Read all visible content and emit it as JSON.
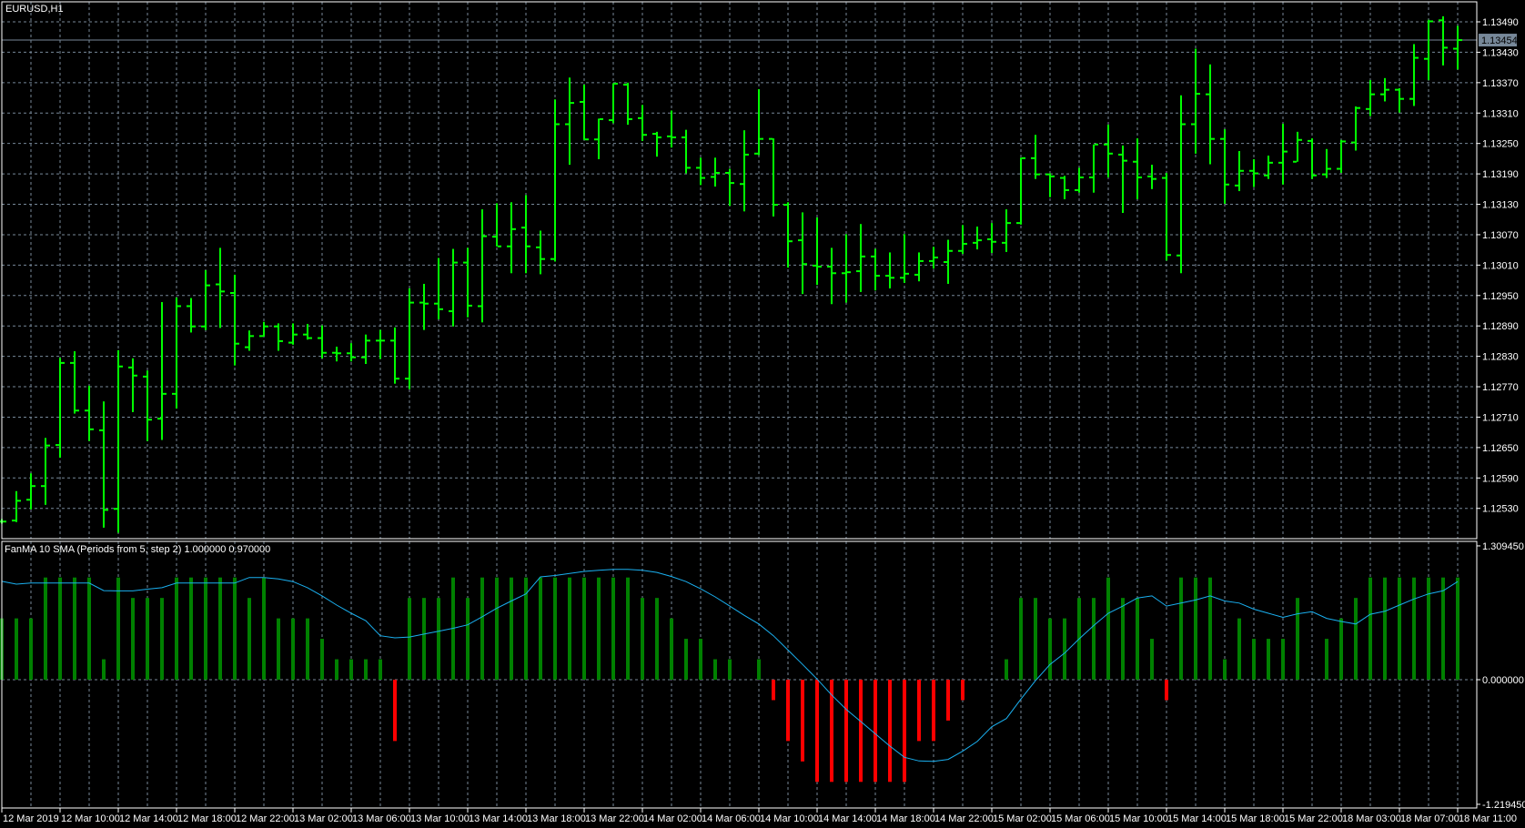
{
  "colors": {
    "background": "#000000",
    "frame": "#ffffff",
    "grid": "#778899",
    "bar": "#00ff00",
    "hist_up": "#008000",
    "hist_down": "#ff0000",
    "signal_line": "#1ab0f0",
    "bid_box": "#778899"
  },
  "chart_data": [
    {
      "type": "bar",
      "style": "ohlc",
      "title": "EURUSD,H1",
      "bid": 1.13454,
      "bid_label": "1.13454",
      "ylim": [
        1.1247,
        1.13529
      ],
      "y_tick_labels": [
        "1.13490",
        "1.13430",
        "1.13370",
        "1.13310",
        "1.13250",
        "1.13190",
        "1.13130",
        "1.13070",
        "1.13010",
        "1.12950",
        "1.12890",
        "1.12830",
        "1.12770",
        "1.12710",
        "1.12650",
        "1.12590",
        "1.12530"
      ],
      "x_tick_labels": [
        "12 Mar 2019",
        "12 Mar 10:00",
        "12 Mar 14:00",
        "12 Mar 18:00",
        "12 Mar 22:00",
        "13 Mar 02:00",
        "13 Mar 06:00",
        "13 Mar 10:00",
        "13 Mar 14:00",
        "13 Mar 18:00",
        "13 Mar 22:00",
        "14 Mar 02:00",
        "14 Mar 06:00",
        "14 Mar 10:00",
        "14 Mar 14:00",
        "14 Mar 18:00",
        "14 Mar 22:00",
        "15 Mar 02:00",
        "15 Mar 06:00",
        "15 Mar 10:00",
        "15 Mar 14:00",
        "15 Mar 18:00",
        "15 Mar 22:00",
        "18 Mar 03:00",
        "18 Mar 07:00",
        "18 Mar 11:00"
      ],
      "x_tick_every_bars": 4,
      "grid": true,
      "ohlc": [
        [
          1.12504,
          1.12509,
          1.125,
          1.12504
        ],
        [
          1.12506,
          1.12564,
          1.12503,
          1.12545
        ],
        [
          1.12547,
          1.12599,
          1.12528,
          1.12574
        ],
        [
          1.12574,
          1.12669,
          1.12537,
          1.12654
        ],
        [
          1.12655,
          1.12827,
          1.1263,
          1.12817
        ],
        [
          1.12817,
          1.1284,
          1.12717,
          1.12723
        ],
        [
          1.12723,
          1.12772,
          1.12663,
          1.12686
        ],
        [
          1.12684,
          1.12741,
          1.12492,
          1.12527
        ],
        [
          1.12529,
          1.12842,
          1.12482,
          1.1281
        ],
        [
          1.12808,
          1.12826,
          1.1272,
          1.12792
        ],
        [
          1.1279,
          1.12802,
          1.12663,
          1.12705
        ],
        [
          1.12707,
          1.12937,
          1.12665,
          1.12756
        ],
        [
          1.12756,
          1.12946,
          1.12727,
          1.12929
        ],
        [
          1.12929,
          1.12945,
          1.12877,
          1.12889
        ],
        [
          1.12889,
          1.13,
          1.12882,
          1.1297
        ],
        [
          1.12972,
          1.13044,
          1.12886,
          1.12958
        ],
        [
          1.12955,
          1.12991,
          1.12812,
          1.12855
        ],
        [
          1.12848,
          1.12881,
          1.12841,
          1.1287
        ],
        [
          1.1287,
          1.12898,
          1.12869,
          1.12889
        ],
        [
          1.12889,
          1.12895,
          1.12841,
          1.1286
        ],
        [
          1.12857,
          1.12895,
          1.12853,
          1.12873
        ],
        [
          1.12873,
          1.12894,
          1.12863,
          1.12866
        ],
        [
          1.12866,
          1.12891,
          1.12826,
          1.12837
        ],
        [
          1.12837,
          1.12849,
          1.1282,
          1.12836
        ],
        [
          1.12836,
          1.12856,
          1.1282,
          1.12828
        ],
        [
          1.12828,
          1.12873,
          1.12815,
          1.12861
        ],
        [
          1.12861,
          1.12882,
          1.12825,
          1.12861
        ],
        [
          1.12861,
          1.12887,
          1.12776,
          1.12786
        ],
        [
          1.12786,
          1.12964,
          1.12765,
          1.12936
        ],
        [
          1.12936,
          1.12973,
          1.12882,
          1.12934
        ],
        [
          1.12934,
          1.13024,
          1.12903,
          1.12923
        ],
        [
          1.12919,
          1.13042,
          1.12889,
          1.13015
        ],
        [
          1.13015,
          1.13044,
          1.12907,
          1.1293
        ],
        [
          1.12929,
          1.1312,
          1.12897,
          1.13067
        ],
        [
          1.13066,
          1.13132,
          1.13047,
          1.13047
        ],
        [
          1.13047,
          1.13134,
          1.12994,
          1.13081
        ],
        [
          1.13084,
          1.13148,
          1.12994,
          1.13047
        ],
        [
          1.13045,
          1.13078,
          1.12992,
          1.13022
        ],
        [
          1.13022,
          1.13337,
          1.13017,
          1.13288
        ],
        [
          1.13288,
          1.1338,
          1.13208,
          1.1333
        ],
        [
          1.13332,
          1.13366,
          1.13257,
          1.13258
        ],
        [
          1.13258,
          1.13299,
          1.13219,
          1.13298
        ],
        [
          1.13296,
          1.13369,
          1.1329,
          1.13368
        ],
        [
          1.13366,
          1.1337,
          1.13287,
          1.13298
        ],
        [
          1.133,
          1.13326,
          1.13255,
          1.13267
        ],
        [
          1.13269,
          1.13273,
          1.13224,
          1.13262
        ],
        [
          1.13264,
          1.13315,
          1.13242,
          1.13262
        ],
        [
          1.13262,
          1.13277,
          1.13191,
          1.13202
        ],
        [
          1.13202,
          1.13222,
          1.13168,
          1.13182
        ],
        [
          1.13184,
          1.13222,
          1.13165,
          1.13192
        ],
        [
          1.13192,
          1.132,
          1.13127,
          1.13172
        ],
        [
          1.1317,
          1.13276,
          1.13116,
          1.13228
        ],
        [
          1.1323,
          1.13357,
          1.13227,
          1.13259
        ],
        [
          1.13259,
          1.1326,
          1.13106,
          1.13129
        ],
        [
          1.13129,
          1.13134,
          1.13005,
          1.13057
        ],
        [
          1.13059,
          1.13114,
          1.12953,
          1.13012
        ],
        [
          1.13009,
          1.13104,
          1.12971,
          1.13007
        ],
        [
          1.13007,
          1.13044,
          1.12933,
          1.12994
        ],
        [
          1.12994,
          1.13071,
          1.12936,
          1.12996
        ],
        [
          1.12998,
          1.13091,
          1.12957,
          1.13027
        ],
        [
          1.13027,
          1.13042,
          1.1296,
          1.12989
        ],
        [
          1.12989,
          1.13035,
          1.12964,
          1.12985
        ],
        [
          1.12985,
          1.13071,
          1.12975,
          1.12993
        ],
        [
          1.12991,
          1.13035,
          1.12978,
          1.13018
        ],
        [
          1.13018,
          1.13046,
          1.13003,
          1.13025
        ],
        [
          1.13016,
          1.1306,
          1.12973,
          1.13038
        ],
        [
          1.13038,
          1.13089,
          1.13032,
          1.13052
        ],
        [
          1.13054,
          1.13086,
          1.13041,
          1.13059
        ],
        [
          1.13061,
          1.13093,
          1.13034,
          1.13056
        ],
        [
          1.13054,
          1.1312,
          1.13036,
          1.13093
        ],
        [
          1.13093,
          1.13222,
          1.1309,
          1.13221
        ],
        [
          1.13221,
          1.13267,
          1.1318,
          1.13189
        ],
        [
          1.13189,
          1.13191,
          1.13144,
          1.13185
        ],
        [
          1.13182,
          1.13186,
          1.1314,
          1.13158
        ],
        [
          1.13158,
          1.13202,
          1.13153,
          1.13183
        ],
        [
          1.13183,
          1.13248,
          1.13153,
          1.13248
        ],
        [
          1.13248,
          1.13287,
          1.13183,
          1.1323
        ],
        [
          1.13228,
          1.13246,
          1.13113,
          1.13216
        ],
        [
          1.13214,
          1.1326,
          1.1314,
          1.13183
        ],
        [
          1.13185,
          1.13208,
          1.1316,
          1.1318
        ],
        [
          1.13182,
          1.13192,
          1.13019,
          1.1303
        ],
        [
          1.13029,
          1.13345,
          1.12994,
          1.13288
        ],
        [
          1.13288,
          1.13437,
          1.1323,
          1.13348
        ],
        [
          1.13347,
          1.13406,
          1.13209,
          1.13259
        ],
        [
          1.13259,
          1.13278,
          1.13131,
          1.13169
        ],
        [
          1.13167,
          1.13235,
          1.13156,
          1.13196
        ],
        [
          1.13196,
          1.13219,
          1.13164,
          1.13191
        ],
        [
          1.13187,
          1.13226,
          1.1318,
          1.13212
        ],
        [
          1.13212,
          1.13289,
          1.13169,
          1.13234
        ],
        [
          1.13214,
          1.13273,
          1.13214,
          1.13257
        ],
        [
          1.13255,
          1.1326,
          1.1318,
          1.13187
        ],
        [
          1.13189,
          1.13239,
          1.13182,
          1.132
        ],
        [
          1.132,
          1.13257,
          1.13192,
          1.13254
        ],
        [
          1.13252,
          1.13323,
          1.13236,
          1.1332
        ],
        [
          1.13318,
          1.13375,
          1.13304,
          1.13347
        ],
        [
          1.13347,
          1.13379,
          1.13333,
          1.13356
        ],
        [
          1.13356,
          1.13359,
          1.13311,
          1.13338
        ],
        [
          1.13338,
          1.13446,
          1.13324,
          1.13419
        ],
        [
          1.13417,
          1.13494,
          1.13375,
          1.13491
        ],
        [
          1.13493,
          1.13501,
          1.13404,
          1.13439
        ],
        [
          1.13437,
          1.13482,
          1.13396,
          1.13454
        ]
      ]
    },
    {
      "type": "bar",
      "title": "FanMA 10 SMA (Periods from 5, step 2) 1.000000 0.970000",
      "ylim": [
        -1.21945,
        1.30945
      ],
      "y_tick_labels": [
        "1.309450",
        "0.000000",
        "-1.219450"
      ],
      "series": [
        {
          "name": "histogram",
          "values": [
            0.6,
            0.6,
            0.6,
            1,
            1,
            1,
            1,
            0.2,
            1,
            0.8,
            0.8,
            0.8,
            1,
            1,
            1,
            1,
            1,
            0.8,
            1,
            0.6,
            0.6,
            0.6,
            0.4,
            0.2,
            0.2,
            0.2,
            0.2,
            -0.6,
            0.8,
            0.8,
            0.8,
            1,
            0.8,
            1,
            1,
            1,
            1,
            1,
            1,
            1,
            1,
            1,
            1,
            1,
            0.8,
            0.8,
            0.6,
            0.4,
            0.4,
            0.2,
            0.2,
            0,
            0.2,
            -0.2,
            -0.6,
            -0.8,
            -1,
            -1,
            -1,
            -1,
            -1,
            -1,
            -1,
            -0.6,
            -0.6,
            -0.4,
            -0.2,
            0,
            0,
            0.2,
            0.8,
            0.8,
            0.6,
            0.6,
            0.8,
            0.8,
            1,
            0.8,
            0.8,
            0.4,
            -0.2,
            1,
            1,
            1,
            0.2,
            0.6,
            0.4,
            0.4,
            0.4,
            0.8,
            0,
            0.4,
            0.6,
            0.8,
            1,
            1,
            1,
            1,
            1,
            1,
            1
          ]
        },
        {
          "name": "line",
          "type": "line",
          "values": [
            0.963,
            0.935,
            0.946,
            0.946,
            0.946,
            0.946,
            0.946,
            0.872,
            0.869,
            0.869,
            0.886,
            0.9,
            0.946,
            0.946,
            0.946,
            0.946,
            0.946,
            1.0,
            1.0,
            0.986,
            0.96,
            0.9,
            0.82,
            0.73,
            0.65,
            0.577,
            0.43,
            0.41,
            0.418,
            0.446,
            0.474,
            0.503,
            0.537,
            0.616,
            0.7,
            0.77,
            0.84,
            1.006,
            1.02,
            1.04,
            1.06,
            1.07,
            1.08,
            1.08,
            1.07,
            1.05,
            1.01,
            0.96,
            0.89,
            0.81,
            0.72,
            0.63,
            0.545,
            0.43,
            0.29,
            0.15,
            0.006,
            -0.15,
            -0.29,
            -0.41,
            -0.53,
            -0.65,
            -0.76,
            -0.795,
            -0.8,
            -0.78,
            -0.7,
            -0.605,
            -0.46,
            -0.38,
            -0.19,
            -0.01,
            0.15,
            0.26,
            0.4,
            0.53,
            0.65,
            0.72,
            0.8,
            0.82,
            0.72,
            0.75,
            0.78,
            0.82,
            0.77,
            0.75,
            0.69,
            0.65,
            0.61,
            0.645,
            0.665,
            0.6,
            0.57,
            0.545,
            0.64,
            0.67,
            0.73,
            0.79,
            0.84,
            0.87,
            0.96
          ]
        }
      ]
    }
  ]
}
